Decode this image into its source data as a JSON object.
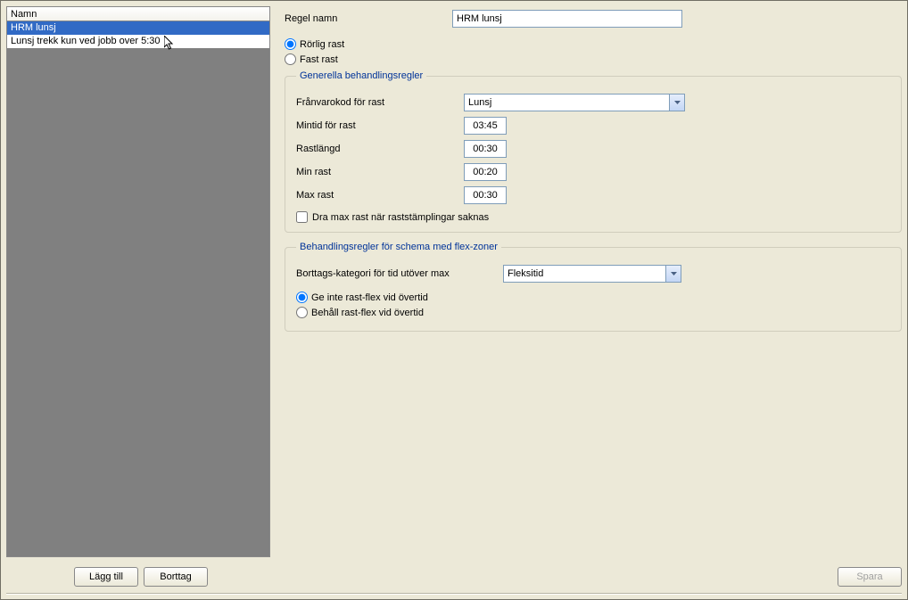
{
  "list": {
    "header": "Namn",
    "items": [
      {
        "label": "HRM lunsj",
        "selected": true
      },
      {
        "label": "Lunsj trekk kun ved jobb over 5:30",
        "selected": false
      }
    ]
  },
  "form": {
    "ruleNameLabel": "Regel namn",
    "ruleName": "HRM lunsj",
    "radio": {
      "rorlig": "Rörlig rast",
      "fast": "Fast rast"
    }
  },
  "group1": {
    "legend": "Generella behandlingsregler",
    "absenceCodeLabel": "Frånvarokod för rast",
    "absenceCode": "Lunsj",
    "minTimeLabel": "Mintid för rast",
    "minTime": "03:45",
    "lengthLabel": "Rastlängd",
    "length": "00:30",
    "minBreakLabel": "Min rast",
    "minBreak": "00:20",
    "maxBreakLabel": "Max rast",
    "maxBreak": "00:30",
    "checkboxLabel": "Dra max rast när raststämplingar saknas"
  },
  "group2": {
    "legend": "Behandlingsregler för schema med flex-zoner",
    "removalCatLabel": "Borttags-kategori för tid utöver max",
    "removalCat": "Fleksitid",
    "radio": {
      "noFlex": "Ge inte rast-flex vid övertid",
      "keepFlex": "Behåll rast-flex vid övertid"
    }
  },
  "buttons": {
    "add": "Lägg till",
    "remove": "Borttag",
    "save": "Spara"
  }
}
